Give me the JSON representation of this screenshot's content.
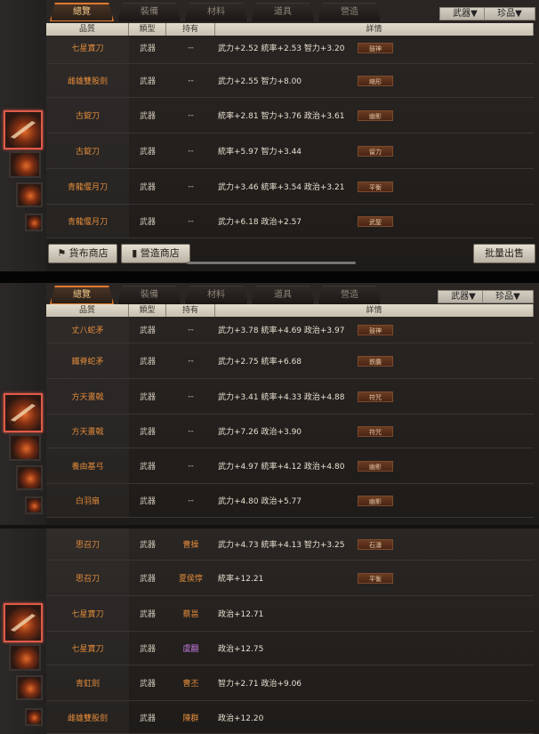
{
  "tabs": [
    "總覽",
    "裝備",
    "材料",
    "道具",
    "營造"
  ],
  "filters": [
    "武器▼",
    "珍品▼"
  ],
  "columns": [
    "品質",
    "類型",
    "持有",
    "詳情"
  ],
  "panel1_rows": [
    {
      "name": "七星寶刀",
      "type": "武器",
      "owner": "--",
      "stats": "武力+2.52  統率+2.53  智力+3.20",
      "badge": "鼓神"
    },
    {
      "name": "雌雄雙股劍",
      "type": "武器",
      "owner": "--",
      "stats": "武力+2.55  智力+8.00",
      "badge": "縮形"
    },
    {
      "name": "古錠刀",
      "type": "武器",
      "owner": "--",
      "stats": "統率+2.81  智力+3.76  政治+3.61",
      "badge": "幽影"
    },
    {
      "name": "古錠刀",
      "type": "武器",
      "owner": "--",
      "stats": "統率+5.97  智力+3.44",
      "badge": "留力"
    },
    {
      "name": "青龍偃月刀",
      "type": "武器",
      "owner": "--",
      "stats": "武力+3.46  統率+3.54  政治+3.21",
      "badge": "平衡"
    },
    {
      "name": "青龍偃月刀",
      "type": "武器",
      "owner": "--",
      "stats": "武力+6.18  政治+2.57",
      "badge": "武聖"
    }
  ],
  "buttons": {
    "shop1": "貨布商店",
    "shop2": "營造商店",
    "bulk_sell": "批量出售"
  },
  "panel2_rows": [
    {
      "name": "丈八蛇矛",
      "type": "武器",
      "owner": "--",
      "stats": "武力+3.78  統率+4.69  政治+3.97",
      "badge": "鼓神"
    },
    {
      "name": "鐵脊蛇矛",
      "type": "武器",
      "owner": "--",
      "stats": "武力+2.75  統率+6.68",
      "badge": "鉄膽"
    },
    {
      "name": "方天畫戟",
      "type": "武器",
      "owner": "--",
      "stats": "武力+3.41  統率+4.33  政治+4.88",
      "badge": "符咒"
    },
    {
      "name": "方天畫戟",
      "type": "武器",
      "owner": "--",
      "stats": "武力+7.26  政治+3.90",
      "badge": "符咒"
    },
    {
      "name": "養由基弓",
      "type": "武器",
      "owner": "--",
      "stats": "武力+4.97  統率+4.12  政治+4.80",
      "badge": "幽影"
    },
    {
      "name": "白羽扇",
      "type": "武器",
      "owner": "--",
      "stats": "武力+4.80  政治+5.77",
      "badge": "幽影"
    }
  ],
  "panel3_rows": [
    {
      "name": "思召刀",
      "type": "武器",
      "owner": "曹操",
      "owner_style": "gold",
      "stats": "武力+4.73  統率+4.13  智力+3.25",
      "badge": "石濤"
    },
    {
      "name": "思召刀",
      "type": "武器",
      "owner": "夏侯惇",
      "owner_style": "gold",
      "stats": "統率+12.21",
      "badge": "平衡"
    },
    {
      "name": "七星寶刀",
      "type": "武器",
      "owner": "蔡邕",
      "owner_style": "gold",
      "stats": "政治+12.71",
      "badge": ""
    },
    {
      "name": "七星寶刀",
      "type": "武器",
      "owner": "虞翻",
      "owner_style": "purple",
      "stats": "政治+12.75",
      "badge": ""
    },
    {
      "name": "青釭劍",
      "type": "武器",
      "owner": "曹丕",
      "owner_style": "gold",
      "stats": "智力+2.71  政治+9.06",
      "badge": ""
    },
    {
      "name": "雌雄雙股劍",
      "type": "武器",
      "owner": "陳群",
      "owner_style": "gold",
      "stats": "政治+12.20",
      "badge": ""
    }
  ],
  "icons": {
    "thumbnail": "weapon-thumbnail-icon",
    "shop1": "banner-icon",
    "shop2": "lantern-icon"
  }
}
